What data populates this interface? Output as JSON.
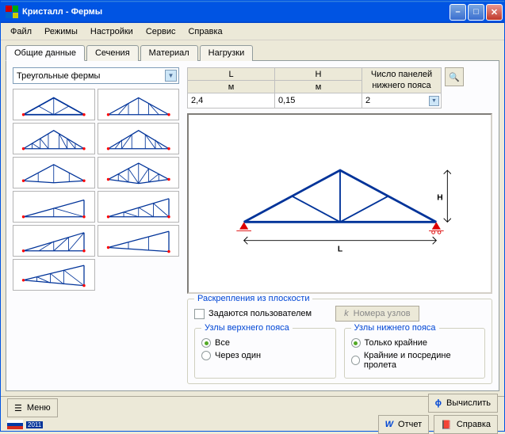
{
  "window": {
    "title": "Кристалл - Фермы"
  },
  "menubar": {
    "file": "Файл",
    "modes": "Режимы",
    "settings": "Настройки",
    "service": "Сервис",
    "help": "Справка"
  },
  "tabs": {
    "general": "Общие данные",
    "sections": "Сечения",
    "material": "Материал",
    "loads": "Нагрузки"
  },
  "combo": {
    "value": "Треугольные фермы"
  },
  "params": {
    "L_label": "L",
    "L_unit": "м",
    "L_value": "2,4",
    "H_label": "H",
    "H_unit": "м",
    "H_value": "0,15",
    "panels_label1": "Число панелей",
    "panels_label2": "нижнего пояса",
    "panels_value": "2"
  },
  "bracing": {
    "title": "Раскрепления из плоскости",
    "userdef": "Задаются пользователем",
    "nodes_btn": "Номера узлов"
  },
  "upper": {
    "title": "Узлы верхнего пояса",
    "all": "Все",
    "alt": "Через один"
  },
  "lower": {
    "title": "Узлы нижнего пояса",
    "edges": "Только крайние",
    "mid": "Крайние и посредине пролета"
  },
  "bottom": {
    "menu": "Меню",
    "calc": "Вычислить",
    "report": "Отчет",
    "help": "Справка",
    "year": "2011"
  }
}
